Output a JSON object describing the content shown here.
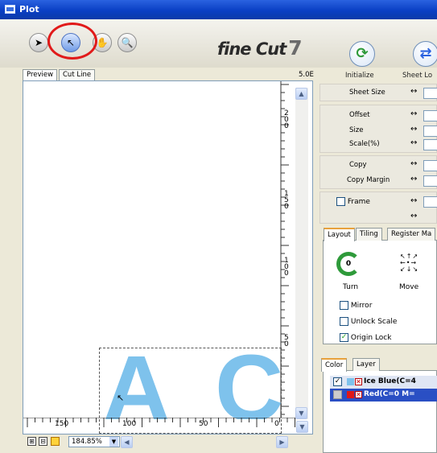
{
  "window": {
    "title": "Plot"
  },
  "toolbar": {
    "tools": [
      {
        "name": "arrow-tool",
        "glyph": "➤"
      },
      {
        "name": "node-tool",
        "glyph": "↖"
      },
      {
        "name": "hand-tool",
        "glyph": "✋"
      },
      {
        "name": "zoom-tool",
        "glyph": "🔍"
      }
    ],
    "logo": "fine Cut 7",
    "logo_main": "fine Cut",
    "logo_num": "7",
    "initialize_label": "Initialize",
    "sheet_label": "Sheet Lo"
  },
  "preview_tabs": [
    "Preview",
    "Cut Line"
  ],
  "scale_label": "5.0E",
  "ruler": {
    "vertical": [
      "2\n0\n0",
      "1\n5\n0",
      "1\n0\n0",
      "5\n0"
    ],
    "horizontal": [
      "150",
      "100",
      "50",
      "0"
    ]
  },
  "canvas_letters": [
    "A",
    "C"
  ],
  "status": {
    "zoom": "184.85%"
  },
  "properties": {
    "sheet_size": "Sheet Size",
    "offset": "Offset",
    "size": "Size",
    "scale": "Scale(%)",
    "copy": "Copy",
    "copy_margin": "Copy Margin",
    "frame": "Frame",
    "arrow": "↔"
  },
  "layout_tabs": [
    "Layout",
    "Tiling",
    "Register Ma"
  ],
  "layout": {
    "turn_label": "Turn",
    "turn_value": "0",
    "move_label": "Move",
    "mirror": "Mirror",
    "unlock_scale": "Unlock Scale",
    "origin_lock": "Origin Lock"
  },
  "color_tabs": [
    "Color",
    "Layer"
  ],
  "colors": [
    {
      "name": "Ice Blue(C=4",
      "swatch": "#7ec2ec",
      "checked": true
    },
    {
      "name": "Red(C=0 M=",
      "swatch": "#e01818",
      "checked": false
    }
  ],
  "accent": {
    "selection": "#2a4fc4",
    "callout": "#e11a1a",
    "letters": "#7ec2ec"
  }
}
